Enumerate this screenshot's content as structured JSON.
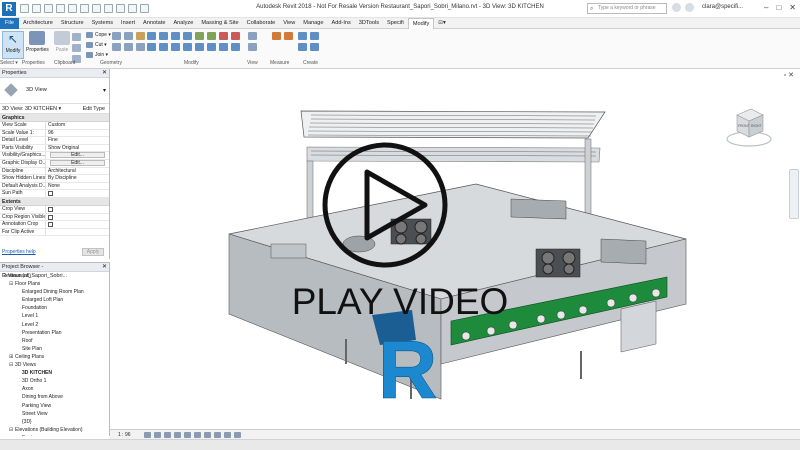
{
  "app": {
    "window_title": "Autodesk Revit 2018 - Not For Resale Version    Restaurant_Sapori_Sobri_Milano.rvt - 3D View: 3D KITCHEN",
    "search_placeholder": "Type a keyword or phrase",
    "user": "clara@specifi...",
    "logo": "R",
    "window_controls": [
      "–",
      "□",
      "✕"
    ]
  },
  "tabs": [
    "File",
    "Architecture",
    "Structure",
    "Systems",
    "Insert",
    "Annotate",
    "Analyze",
    "Massing & Site",
    "Collaborate",
    "View",
    "Manage",
    "Add-Ins",
    "3DTools",
    "Specifi",
    "Modify",
    "⊡▾"
  ],
  "ribbon": {
    "modify_label": "Modify",
    "select_label": "Select ▾",
    "properties_label": "Properties",
    "paste_label": "Paste",
    "clipboard_label": "Clipboard",
    "geometry_label": "Geometry",
    "modify_panel_label": "Modify",
    "view_label": "View",
    "measure_label": "Measure",
    "create_label": "Create",
    "small_tools": [
      "Cope ▾",
      "Cut ▾",
      "Join ▾"
    ]
  },
  "properties": {
    "title": "Properties",
    "type_name": "3D View",
    "instance_label": "3D View: 3D KITCHEN",
    "edit_type": "Edit Type",
    "group_graphics": "Graphics",
    "rows": [
      {
        "k": "View Scale",
        "v": "Custom"
      },
      {
        "k": "Scale Value    1:",
        "v": "96"
      },
      {
        "k": "Detail Level",
        "v": "Fine"
      },
      {
        "k": "Parts Visibility",
        "v": "Show Original"
      },
      {
        "k": "Visibility/Graphics...",
        "v": "Edit..."
      },
      {
        "k": "Graphic Display O...",
        "v": "Edit..."
      },
      {
        "k": "Discipline",
        "v": "Architectural"
      },
      {
        "k": "Show Hidden Lines",
        "v": "By Discipline"
      },
      {
        "k": "Default Analysis D...",
        "v": "None"
      },
      {
        "k": "Sun Path",
        "v": ""
      }
    ],
    "group_extents": "Extents",
    "extent_rows": [
      {
        "k": "Crop View",
        "v": ""
      },
      {
        "k": "Crop Region Visible",
        "v": ""
      },
      {
        "k": "Annotation Crop",
        "v": ""
      },
      {
        "k": "Far Clip Active",
        "v": ""
      }
    ],
    "help": "Properties help",
    "apply": "Apply"
  },
  "browser": {
    "title": "Project Browser - Restaurant_Sapori_Sobri...",
    "items": [
      {
        "text": "Views (all)",
        "level": 0,
        "tog": "⊟",
        "bold": false
      },
      {
        "text": "Floor Plans",
        "level": 1,
        "tog": "⊟",
        "bold": false
      },
      {
        "text": "Enlarged Dining Room Plan",
        "level": 2,
        "tog": "",
        "bold": false
      },
      {
        "text": "Enlarged Loft Plan",
        "level": 2,
        "tog": "",
        "bold": false
      },
      {
        "text": "Foundation",
        "level": 2,
        "tog": "",
        "bold": false
      },
      {
        "text": "Level 1",
        "level": 2,
        "tog": "",
        "bold": false
      },
      {
        "text": "Level 2",
        "level": 2,
        "tog": "",
        "bold": false
      },
      {
        "text": "Presentation Plan",
        "level": 2,
        "tog": "",
        "bold": false
      },
      {
        "text": "Roof",
        "level": 2,
        "tog": "",
        "bold": false
      },
      {
        "text": "Site Plan",
        "level": 2,
        "tog": "",
        "bold": false
      },
      {
        "text": "Ceiling Plans",
        "level": 1,
        "tog": "⊞",
        "bold": false
      },
      {
        "text": "3D Views",
        "level": 1,
        "tog": "⊟",
        "bold": false
      },
      {
        "text": "3D KITCHEN",
        "level": 2,
        "tog": "",
        "bold": true
      },
      {
        "text": "3D Ortho 1",
        "level": 2,
        "tog": "",
        "bold": false
      },
      {
        "text": "Axon",
        "level": 2,
        "tog": "",
        "bold": false
      },
      {
        "text": "Dining from Above",
        "level": 2,
        "tog": "",
        "bold": false
      },
      {
        "text": "Parking View",
        "level": 2,
        "tog": "",
        "bold": false
      },
      {
        "text": "Street View",
        "level": 2,
        "tog": "",
        "bold": false
      },
      {
        "text": "{3D}",
        "level": 2,
        "tog": "",
        "bold": false
      },
      {
        "text": "Elevations (Building Elevation)",
        "level": 1,
        "tog": "⊟",
        "bold": false
      },
      {
        "text": "East",
        "level": 2,
        "tog": "",
        "bold": false
      }
    ]
  },
  "status": {
    "scale": "1 : 96"
  },
  "viewcube": {
    "front": "FRONT",
    "right": "RIGHT"
  },
  "overlay": {
    "text": "PLAY VIDEO"
  },
  "colors": {
    "accent": "#1f72bd",
    "green_panel": "#1e8a3c",
    "steel": "#bfc3c8"
  }
}
